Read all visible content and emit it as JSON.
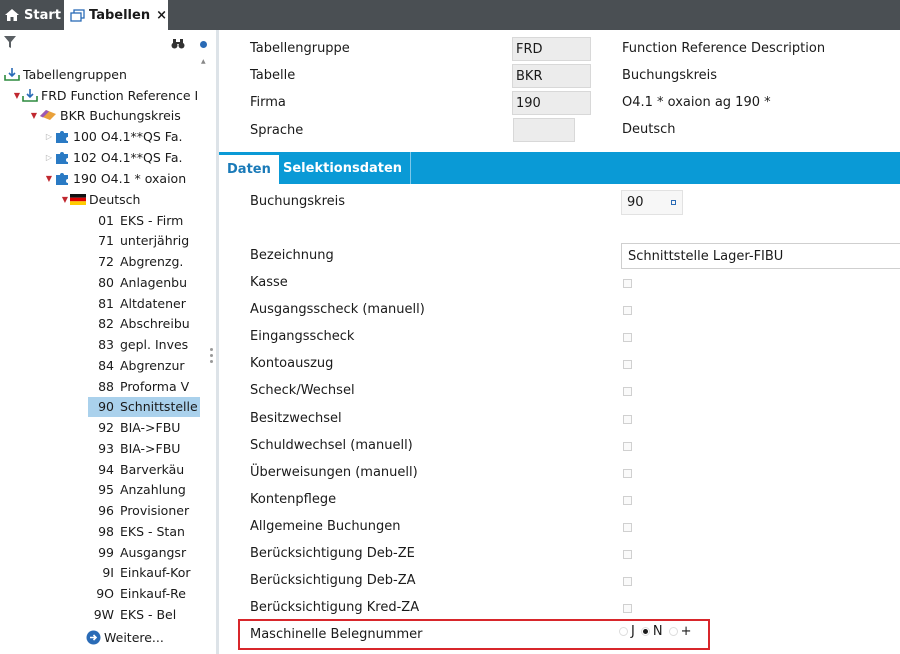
{
  "tabs": {
    "start_label": "Start",
    "tabellen_label": "Tabellen",
    "close_glyph": "×"
  },
  "tree": {
    "root": "Tabellengruppen",
    "frd": "FRD  Function Reference I",
    "bkr": "BKR  Buchungskreis",
    "c100": "100 O4.1**QS Fa.",
    "c102": "102 O4.1**QS Fa.",
    "c190": "190 O4.1 * oxaion",
    "lang": "Deutsch",
    "leaves": [
      {
        "num": "01",
        "text": "EKS - Firm"
      },
      {
        "num": "71",
        "text": "unterjährig"
      },
      {
        "num": "72",
        "text": "Abgrenzg."
      },
      {
        "num": "80",
        "text": "Anlagenbu"
      },
      {
        "num": "81",
        "text": "Altdatener"
      },
      {
        "num": "82",
        "text": "Abschreibu"
      },
      {
        "num": "83",
        "text": "gepl. Inves"
      },
      {
        "num": "84",
        "text": "Abgrenzur"
      },
      {
        "num": "88",
        "text": "Proforma V"
      },
      {
        "num": "90",
        "text": "Schnittstelle"
      },
      {
        "num": "92",
        "text": "BIA->FBU"
      },
      {
        "num": "93",
        "text": "BIA->FBU"
      },
      {
        "num": "94",
        "text": "Barverkäu"
      },
      {
        "num": "95",
        "text": "Anzahlung"
      },
      {
        "num": "96",
        "text": "Provisioner"
      },
      {
        "num": "98",
        "text": "EKS - Stan"
      },
      {
        "num": "99",
        "text": "Ausgangsr"
      },
      {
        "num": "9I",
        "text": "Einkauf-Kor"
      },
      {
        "num": "9O",
        "text": "Einkauf-Re"
      },
      {
        "num": "9W",
        "text": "EKS - Bel"
      }
    ],
    "more": "Weitere..."
  },
  "header": {
    "tabellengruppe_label": "Tabellengruppe",
    "tabellengruppe_value": "FRD",
    "tabellengruppe_desc": "Function Reference Description",
    "tabelle_label": "Tabelle",
    "tabelle_value": "BKR",
    "tabelle_desc": "Buchungskreis",
    "firma_label": "Firma",
    "firma_value": "190",
    "firma_desc": "O4.1 * oxaion ag 190   *",
    "sprache_label": "Sprache",
    "sprache_value": "",
    "sprache_desc": "Deutsch"
  },
  "detail_tabs": {
    "daten": "Daten",
    "selektionsdaten": "Selektionsdaten"
  },
  "form": {
    "buchungskreis_label": "Buchungskreis",
    "buchungskreis_value": "90",
    "bezeichnung_label": "Bezeichnung",
    "bezeichnung_value": "Schnittstelle Lager-FIBU",
    "checkboxes": [
      "Kasse",
      "Ausgangsscheck (manuell)",
      "Eingangsscheck",
      "Kontoauszug",
      "Scheck/Wechsel",
      "Besitzwechsel",
      "Schuldwechsel (manuell)",
      "Überweisungen (manuell)",
      "Kontenpflege",
      "Allgemeine Buchungen",
      "Berücksichtigung Deb-ZE",
      "Berücksichtigung Deb-ZA",
      "Berücksichtigung Kred-ZA"
    ],
    "maschinelle_label": "Maschinelle Belegnummer",
    "radio_options": [
      "J",
      "N",
      "+"
    ],
    "radio_selected": "N"
  },
  "colors": {
    "tabbar": "#4a4f53",
    "accent": "#0a9ad6",
    "selection": "#aad1ec",
    "highlight_border": "#d8262b"
  }
}
